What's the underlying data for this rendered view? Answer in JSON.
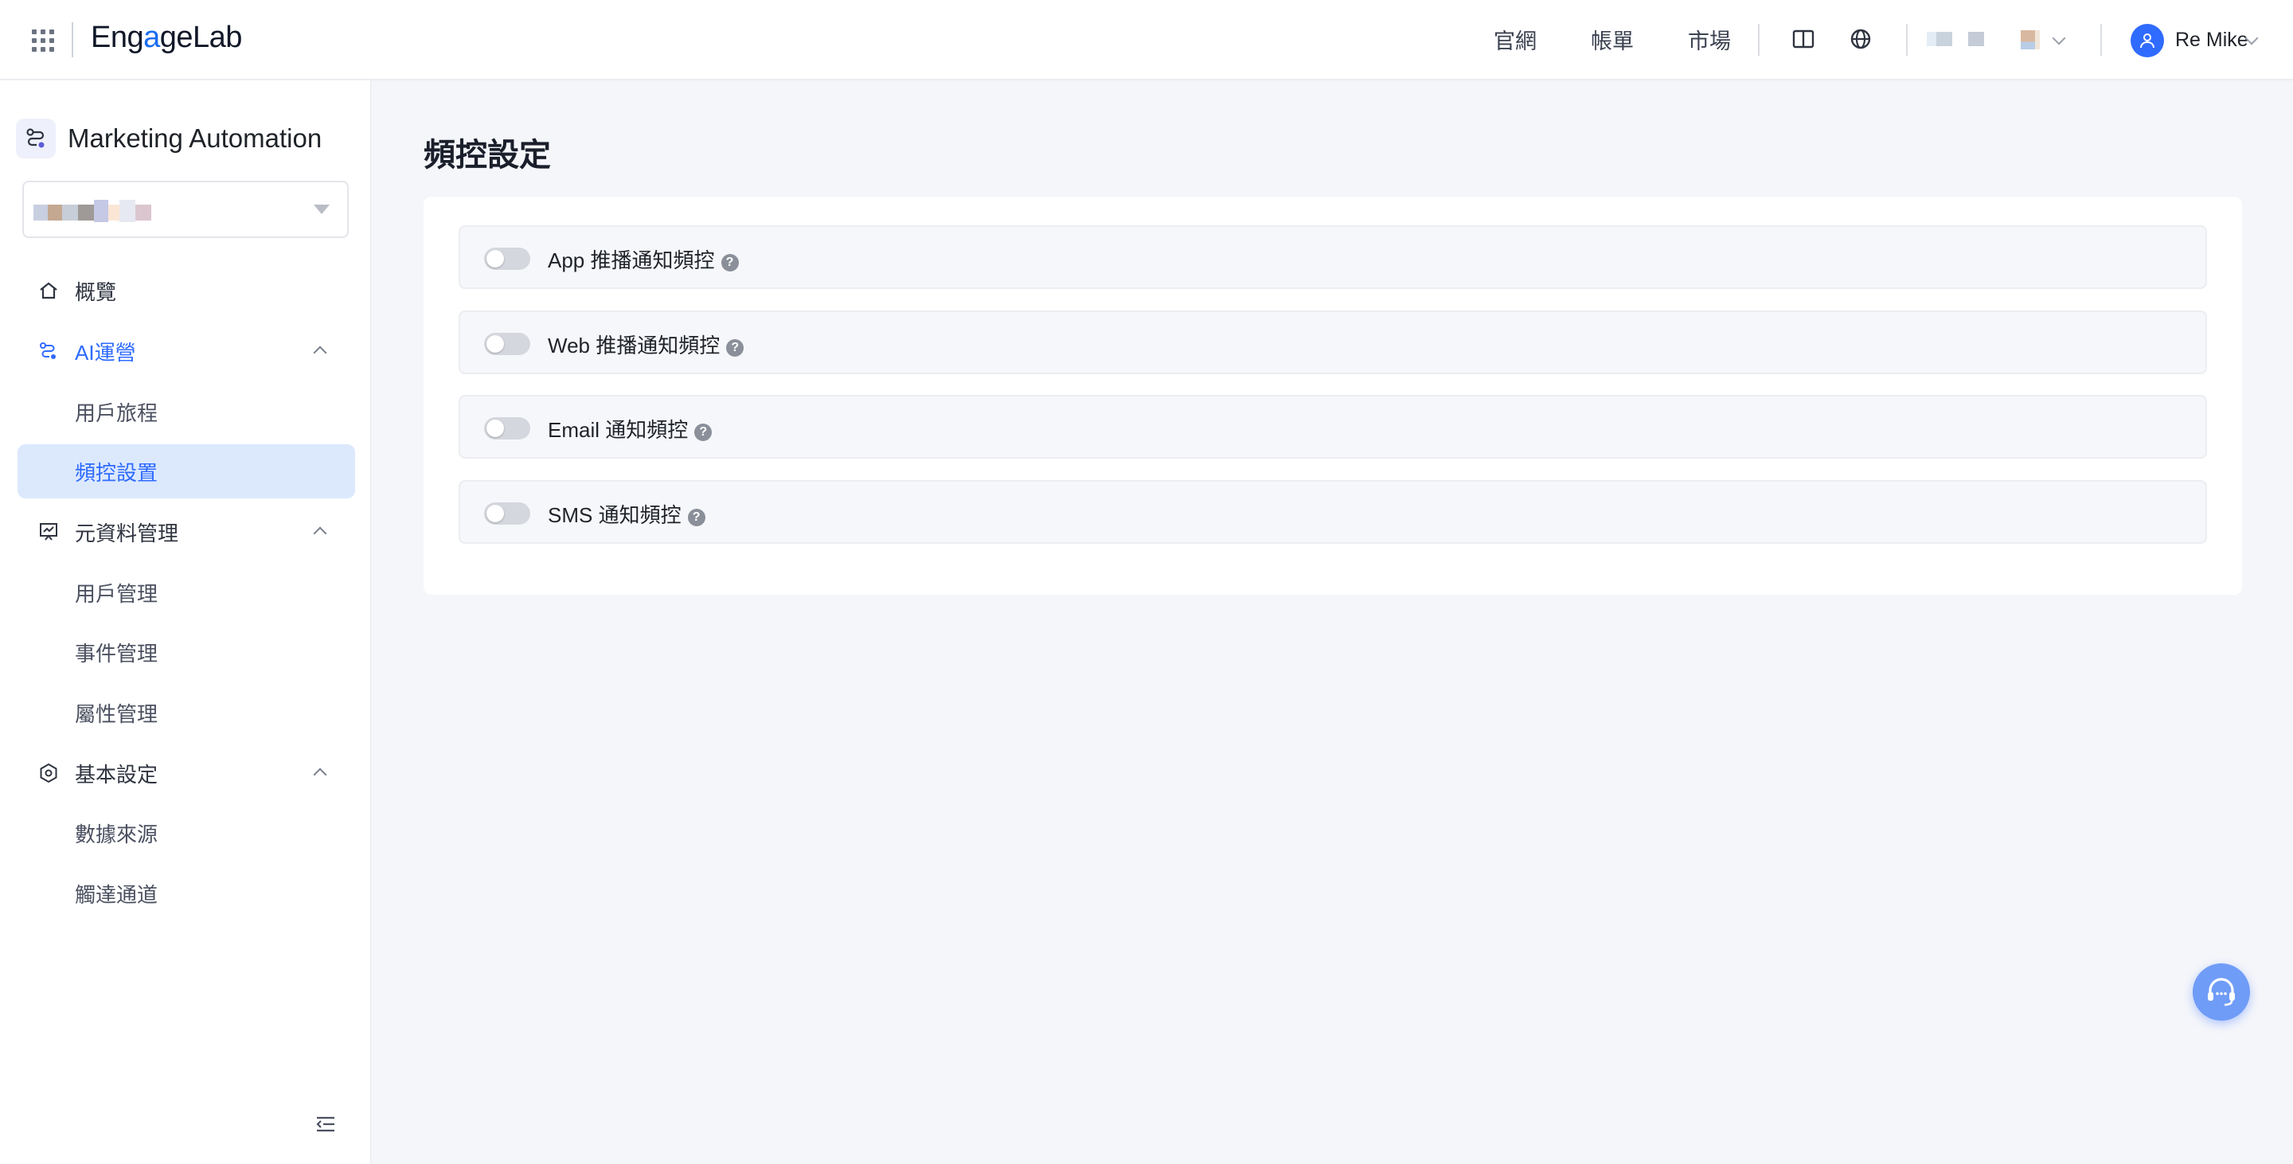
{
  "topbar": {
    "logo_prefix": "Eng",
    "logo_accent": "a",
    "logo_suffix": "geLab",
    "nav": [
      "官網",
      "帳單",
      "市場"
    ],
    "user_name": "Re Mike"
  },
  "sidebar": {
    "brand_title": "Marketing Automation",
    "items": [
      {
        "label": "概覽"
      },
      {
        "label": "AI運營"
      },
      {
        "label": "用戶旅程"
      },
      {
        "label": "頻控設置"
      },
      {
        "label": "元資料管理"
      },
      {
        "label": "用戶管理"
      },
      {
        "label": "事件管理"
      },
      {
        "label": "屬性管理"
      },
      {
        "label": "基本設定"
      },
      {
        "label": "數據來源"
      },
      {
        "label": "觸達通道"
      }
    ]
  },
  "main": {
    "title": "頻控設定",
    "rows": [
      {
        "label": "App 推播通知頻控",
        "enabled": false
      },
      {
        "label": "Web 推播通知頻控",
        "enabled": false
      },
      {
        "label": "Email 通知頻控",
        "enabled": false
      },
      {
        "label": "SMS 通知頻控",
        "enabled": false
      }
    ],
    "help_glyph": "?"
  },
  "colors": {
    "accent": "#2f6bff",
    "active_bg": "#dce9fd",
    "page_bg": "#f5f6fa"
  }
}
